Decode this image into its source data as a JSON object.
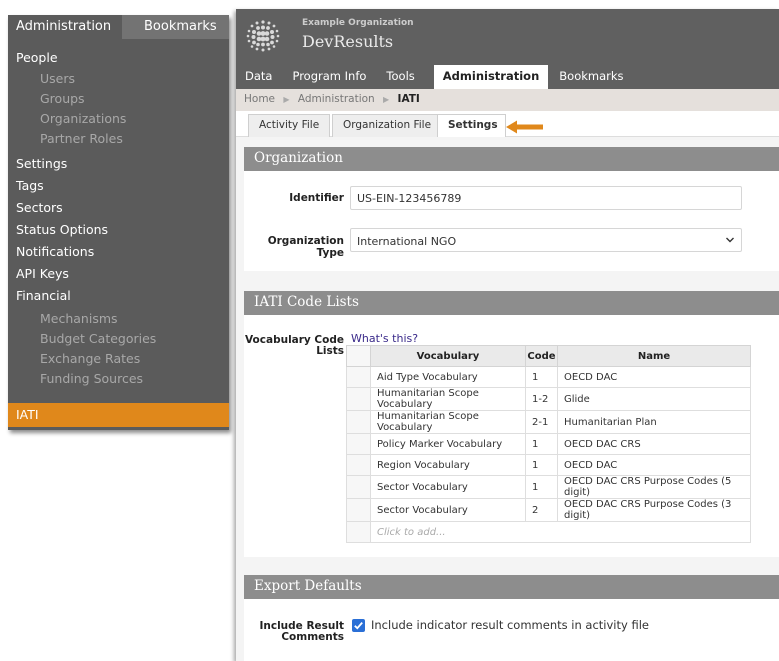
{
  "sidebar": {
    "tabs": {
      "administration": "Administration",
      "bookmarks": "Bookmarks"
    },
    "groups": {
      "people": "People",
      "settings": "Settings",
      "tags": "Tags",
      "sectors": "Sectors",
      "status_options": "Status Options",
      "notifications": "Notifications",
      "api_keys": "API Keys",
      "financial": "Financial",
      "iati": "IATI"
    },
    "people_items": [
      "Users",
      "Groups",
      "Organizations",
      "Partner Roles"
    ],
    "financial_items": [
      "Mechanisms",
      "Budget Categories",
      "Exchange Rates",
      "Funding Sources"
    ]
  },
  "header": {
    "org_name": "Example Organization",
    "app_name": "DevResults",
    "nav": [
      "Data",
      "Program Info",
      "Tools",
      "Administration",
      "Bookmarks"
    ]
  },
  "breadcrumb": [
    "Home",
    "Administration",
    "IATI"
  ],
  "subtabs": [
    "Activity File",
    "Organization File",
    "Settings"
  ],
  "organization": {
    "title": "Organization",
    "identifier_label": "Identifier",
    "identifier_value": "US-EIN-123456789",
    "type_label": "Organization Type",
    "type_value": "International NGO"
  },
  "code_lists": {
    "title": "IATI Code Lists",
    "label_line1": "Vocabulary Code",
    "label_line2": "Lists",
    "whats_this": "What's this?",
    "headers": [
      "Vocabulary",
      "Code",
      "Name"
    ],
    "rows": [
      [
        "Aid Type Vocabulary",
        "1",
        "OECD DAC"
      ],
      [
        "Humanitarian Scope Vocabulary",
        "1-2",
        "Glide"
      ],
      [
        "Humanitarian Scope Vocabulary",
        "2-1",
        "Humanitarian Plan"
      ],
      [
        "Policy Marker Vocabulary",
        "1",
        "OECD DAC CRS"
      ],
      [
        "Region Vocabulary",
        "1",
        "OECD DAC"
      ],
      [
        "Sector Vocabulary",
        "1",
        "OECD DAC CRS Purpose Codes (5 digit)"
      ],
      [
        "Sector Vocabulary",
        "2",
        "OECD DAC CRS Purpose Codes (3 digit)"
      ]
    ],
    "add_placeholder": "Click to add..."
  },
  "export_defaults": {
    "title": "Export Defaults",
    "label_line1": "Include Result",
    "label_line2": "Comments",
    "checkbox_label": "Include indicator result comments in activity file",
    "checked": true
  },
  "colors": {
    "accent": "#e0881b",
    "sidebar_bg": "#5b5b5b",
    "header_bg": "#606060",
    "section_header": "#8d8d8d",
    "checkbox": "#2a6fd6"
  }
}
